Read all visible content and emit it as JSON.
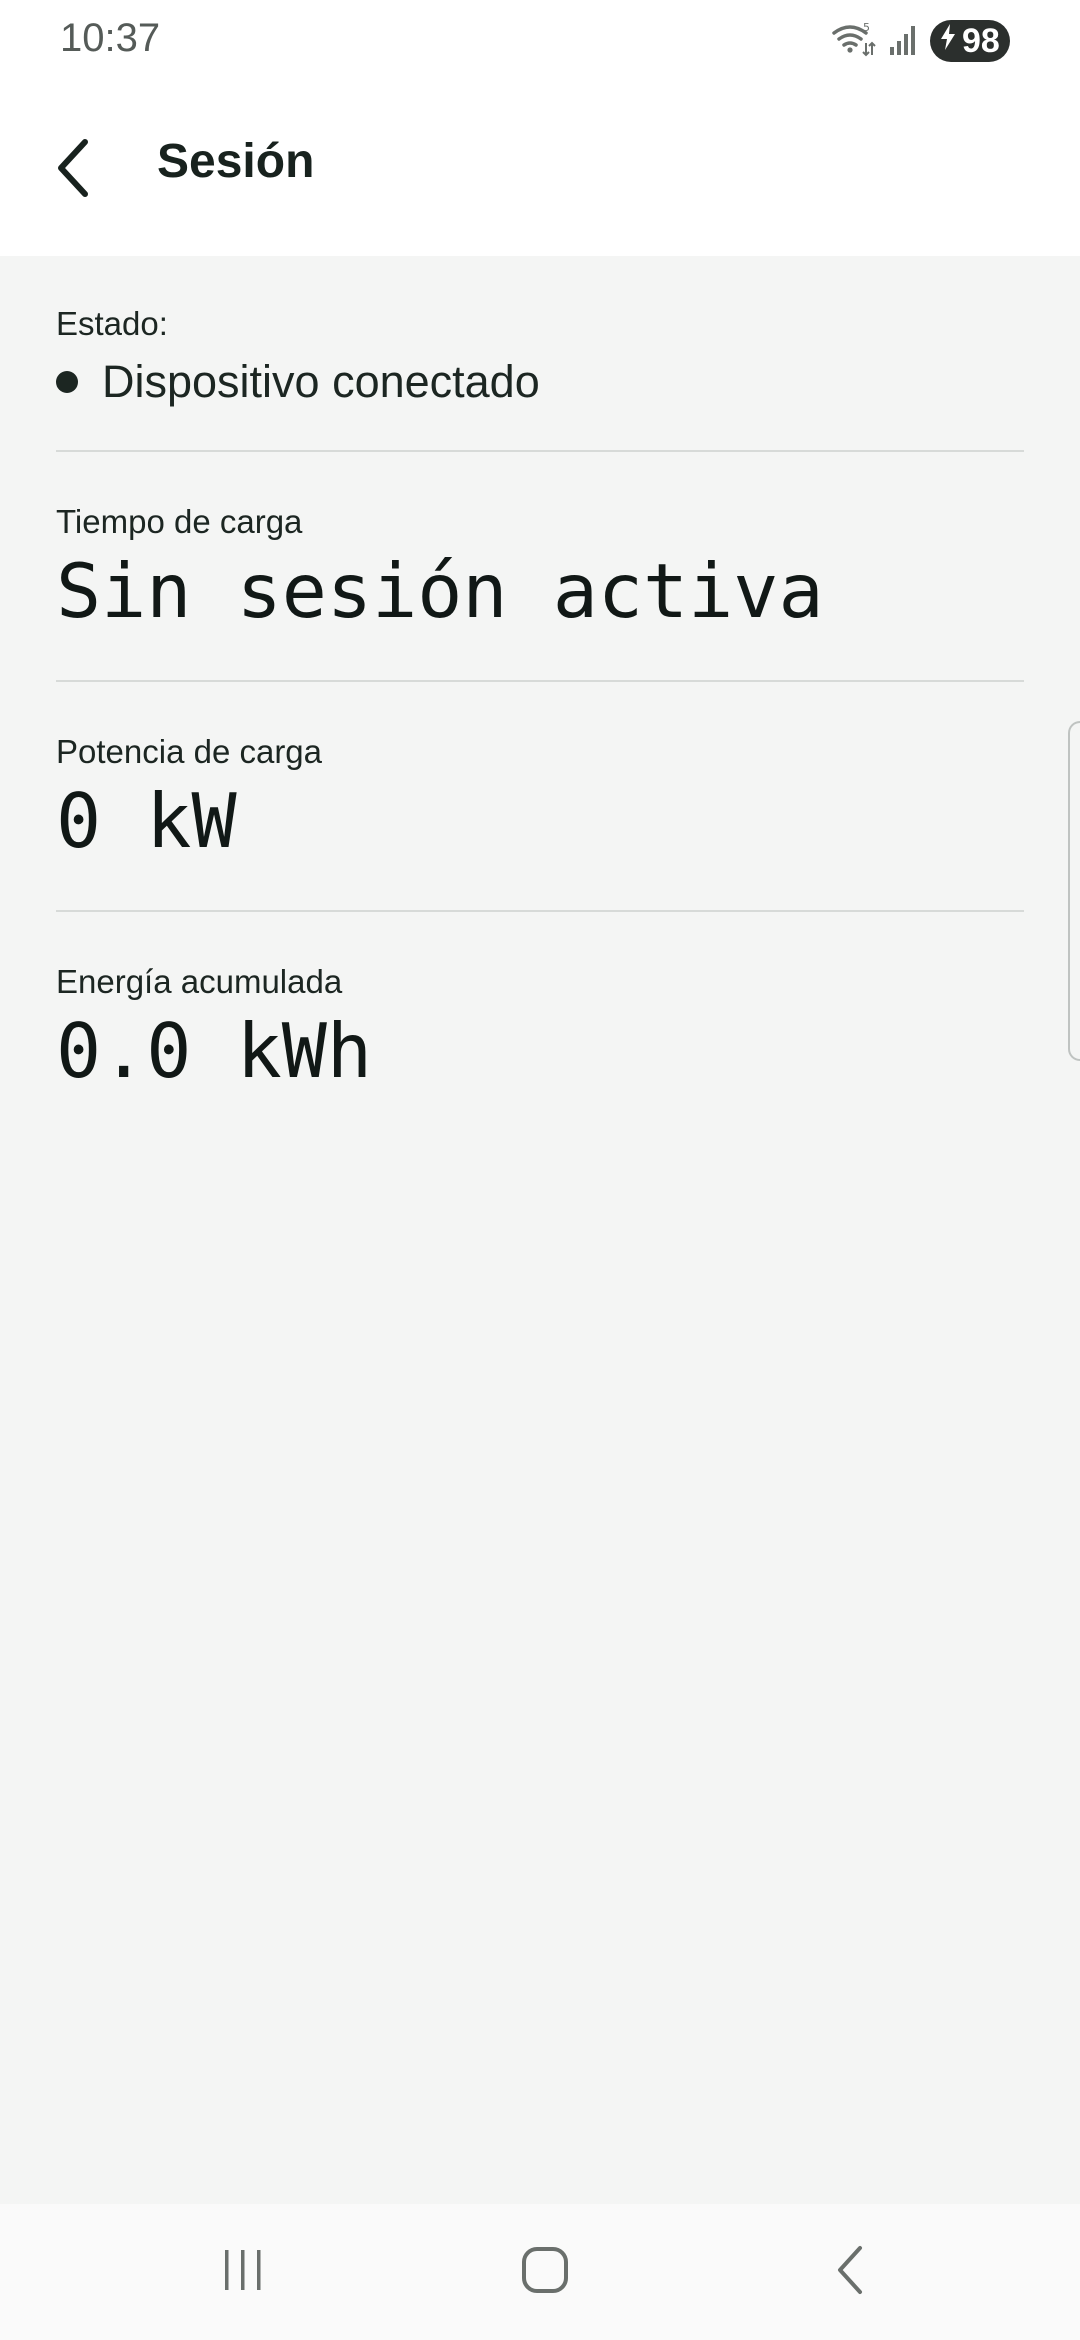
{
  "status_bar": {
    "time": "10:37",
    "wifi_icon": "wifi-5g-icon",
    "signal_icon": "cell-signal-icon",
    "battery_level": "98",
    "charging_icon": "lightning-icon"
  },
  "app_bar": {
    "title": "Sesión",
    "back_icon": "chevron-left-icon"
  },
  "session": {
    "status_label": "Estado:",
    "status_value": "Dispositivo conectado",
    "charge_time_label": "Tiempo de carga",
    "charge_time_value": "Sin sesión activa",
    "power_label": "Potencia de carga",
    "power_value": "0 kW",
    "energy_label": "Energía acumulada",
    "energy_value": "0.0 kWh"
  },
  "nav_bar": {
    "recents_icon": "recents-icon",
    "home_icon": "home-icon",
    "back_icon": "back-icon"
  },
  "colors": {
    "content_bg": "#f4f5f4",
    "text": "#1c2622",
    "divider": "#d7dad8"
  }
}
